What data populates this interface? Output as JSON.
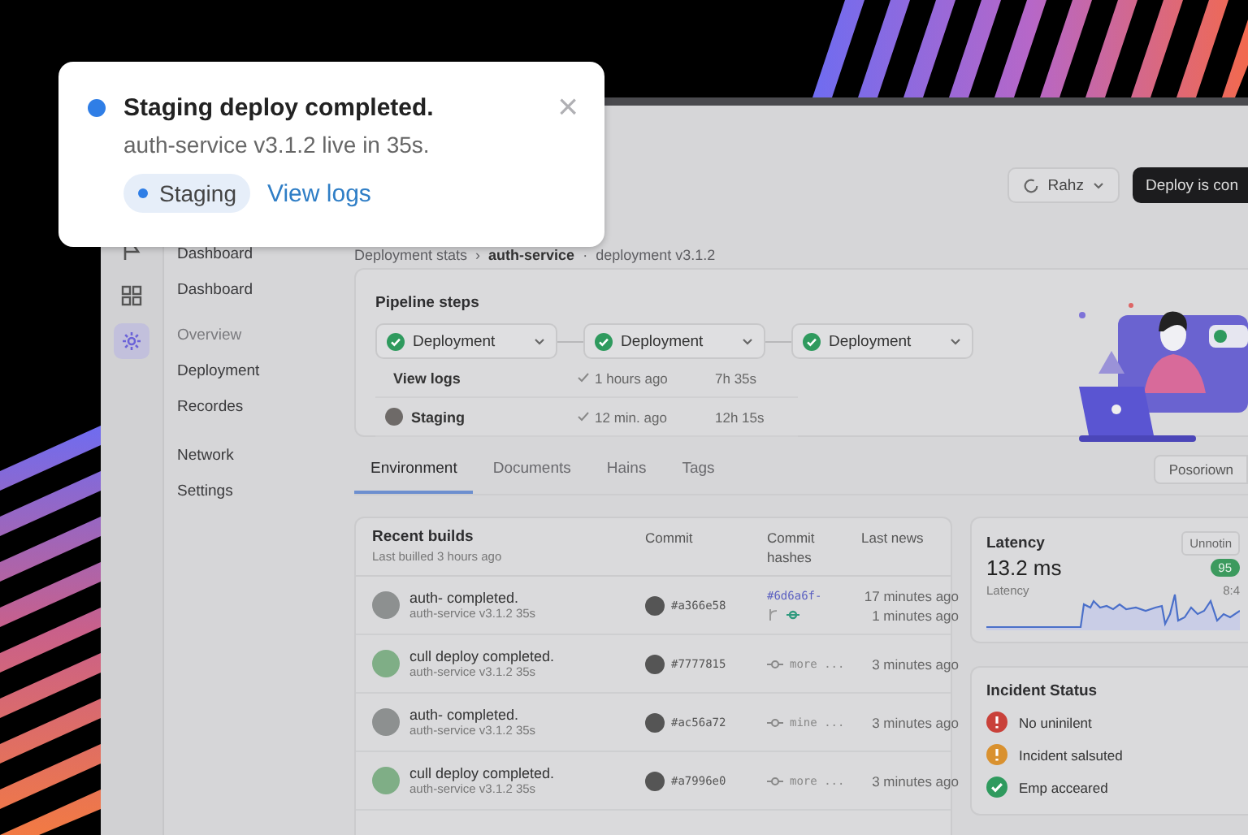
{
  "toast": {
    "title": "Staging deploy completed.",
    "message": "auth-service v3.1.2 live in 35s.",
    "tag": "Staging",
    "link": "View logs",
    "close": "×"
  },
  "topbar": {
    "user_button": "Rahz",
    "deploy_button": "Deploy is con"
  },
  "rail": [
    {
      "kind": "flag",
      "selected": false
    },
    {
      "kind": "grid",
      "selected": false
    },
    {
      "kind": "gear",
      "selected": true
    }
  ],
  "sidebar": {
    "sections": [
      {
        "items": [
          {
            "label": "Dashboard",
            "kind": "link"
          },
          {
            "label": "Dashboard",
            "kind": "link"
          },
          {
            "label": "Overview",
            "kind": "heading"
          },
          {
            "label": "Deployment",
            "kind": "link"
          },
          {
            "label": "Recordes",
            "kind": "link"
          }
        ]
      },
      {
        "items": [
          {
            "label": "Network",
            "kind": "link"
          },
          {
            "label": "Settings",
            "kind": "link"
          }
        ]
      }
    ]
  },
  "breadcrumb": [
    {
      "label": "Deployment stats",
      "bold": false,
      "separator": "›"
    },
    {
      "label": "auth-service",
      "bold": true,
      "separator": "·"
    },
    {
      "label": "deployment v3.1.2",
      "bold": false
    }
  ],
  "pipeline": {
    "title": "Pipeline steps",
    "steps": [
      {
        "label": "Deployment",
        "kind": "success"
      },
      {
        "label": "Deployment",
        "kind": "success"
      },
      {
        "label": "Deployment",
        "kind": "success"
      }
    ],
    "rows": [
      {
        "label": "View logs",
        "avatar": false,
        "time": "1 hours ago",
        "duration": "7h 35s"
      },
      {
        "label": "Staging",
        "avatar": true,
        "time": "12 min. ago",
        "duration": "12h 15s"
      }
    ]
  },
  "tabs": [
    {
      "label": "Environment",
      "selected": true
    },
    {
      "label": "Documents",
      "selected": false
    },
    {
      "label": "Hains",
      "selected": false
    },
    {
      "label": "Tags",
      "selected": false
    }
  ],
  "filter": "Posoriown",
  "builds": {
    "title": "Recent builds",
    "subtitle": "Last builled 3 hours ago",
    "columns": [
      "Commit",
      "Commit hashes",
      "Last news"
    ],
    "rows": [
      {
        "title": "auth- completed.",
        "subtitle": "auth-service v3.1.2 35s",
        "color": "#8d9090",
        "commit": "#a366e58",
        "hash": "#6d6a6f-",
        "kind": "link",
        "times": [
          "17 minutes ago",
          "1 minutes ago"
        ]
      },
      {
        "title": "cull deploy completed.",
        "subtitle": "auth-service v3.1.2 35s",
        "color": "#7fae86",
        "commit": "#7777815",
        "hash": "more ...",
        "kind": "muted",
        "times": [
          "3 minutes ago"
        ]
      },
      {
        "title": "auth- completed.",
        "subtitle": "auth-service v3.1.2 35s",
        "color": "#8d9090",
        "commit": "#ac56a72",
        "hash": "mine ...",
        "kind": "muted",
        "times": [
          "3 minutes ago"
        ]
      },
      {
        "title": "cull deploy completed.",
        "subtitle": "auth-service v3.1.2 35s",
        "color": "#7fae86",
        "commit": "#a7996e0",
        "hash": "more ...",
        "kind": "muted",
        "times": [
          "3 minutes ago"
        ]
      }
    ]
  },
  "latency": {
    "title": "Latency",
    "value": "13.2 ms",
    "caption": "Latency",
    "button": "Unnotin",
    "badge": "95",
    "reading": "8:4"
  },
  "incidents": {
    "title": "Incident Status",
    "items": [
      {
        "label": "No uninilent",
        "kind": "error"
      },
      {
        "label": "Incident salsuted",
        "kind": "warning"
      },
      {
        "label": "Emp acceared",
        "kind": "success"
      }
    ]
  }
}
